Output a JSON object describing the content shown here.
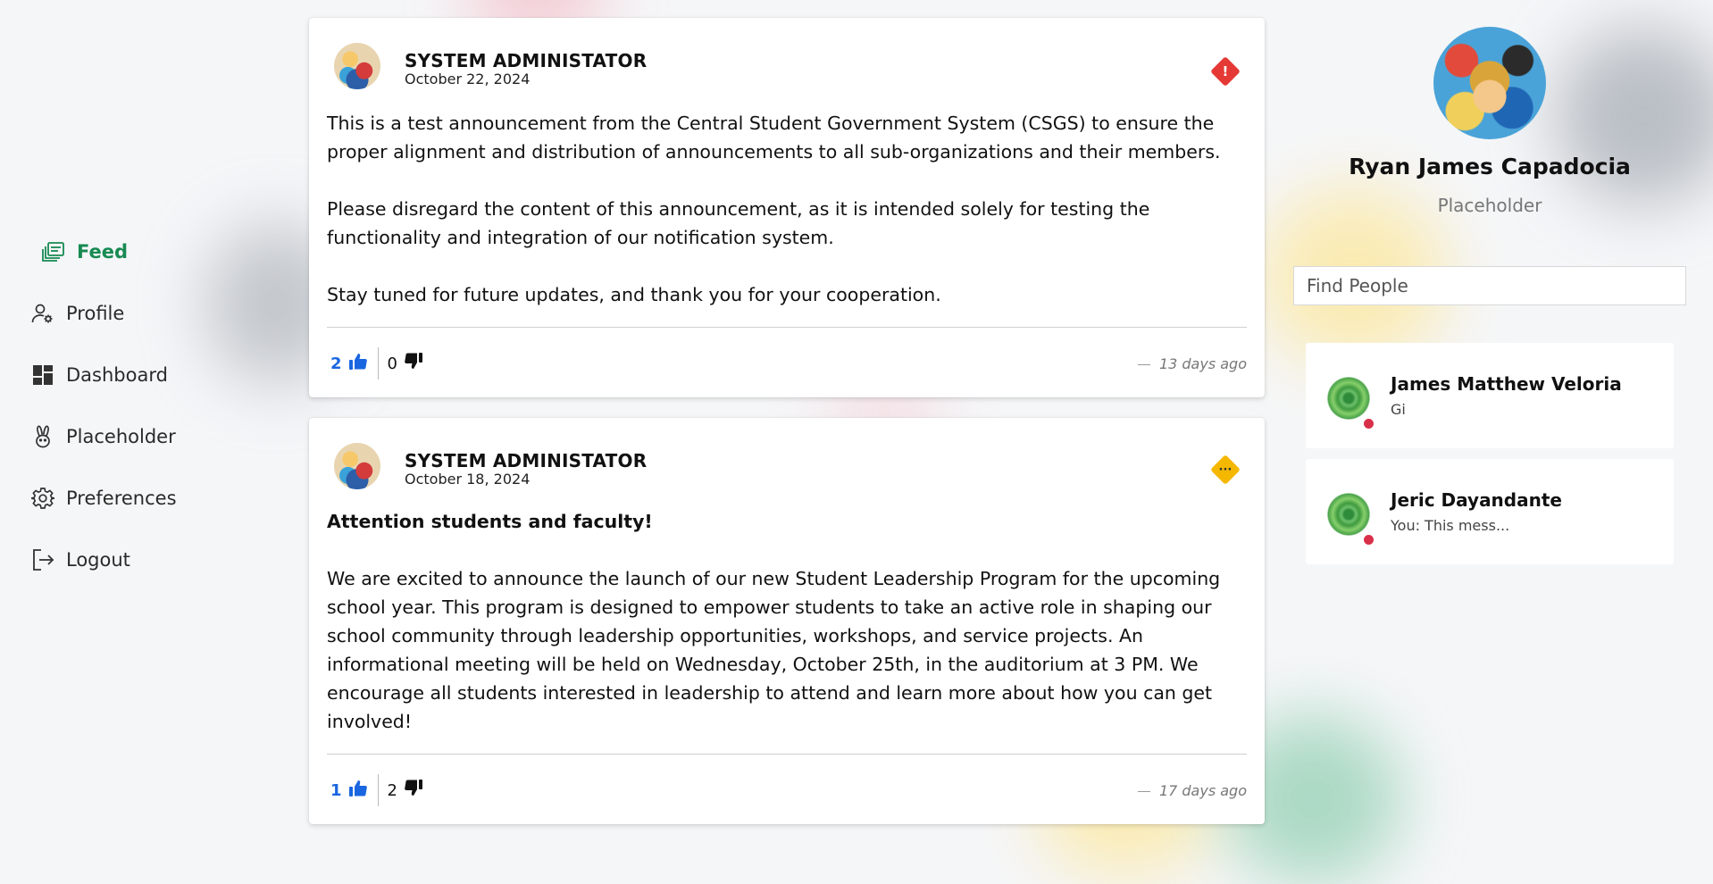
{
  "nav": {
    "items": [
      {
        "label": "Feed",
        "icon": "feed-icon",
        "active": true
      },
      {
        "label": "Profile",
        "icon": "user-settings-icon"
      },
      {
        "label": "Dashboard",
        "icon": "dashboard-icon"
      },
      {
        "label": "Placeholder",
        "icon": "rabbit-icon"
      },
      {
        "label": "Preferences",
        "icon": "gear-icon"
      },
      {
        "label": "Logout",
        "icon": "logout-icon"
      }
    ]
  },
  "posts": [
    {
      "author": "SYSTEM ADMINISTATOR",
      "date": "October 22, 2024",
      "priority_icon": "exclamation-diamond-icon",
      "priority_color": "#e53935",
      "paragraphs": [
        "This is a test announcement from the Central Student Government System (CSGS) to ensure the proper alignment and distribution of announcements to all sub-organizations and their members.",
        "Please disregard the content of this announcement, as it is intended solely for testing the functionality and integration of our notification system.",
        "Stay tuned for future updates, and thank you for your cooperation."
      ],
      "likes": "2",
      "dislikes": "0",
      "time_ago": "13 days ago"
    },
    {
      "author": "SYSTEM ADMINISTATOR",
      "date": "October 18, 2024",
      "priority_icon": "ellipsis-diamond-icon",
      "priority_color": "#f5b800",
      "headline": "Attention students and faculty!",
      "paragraphs": [
        "We are excited to announce the launch of our new Student Leadership Program for the upcoming school year. This program is designed to empower students to take an active role in shaping our school community through leadership opportunities, workshops, and service projects. An informational meeting will be held on Wednesday, October 25th, in the auditorium at 3 PM. We encourage all students interested in leadership to attend and learn more about how you can get involved!"
      ],
      "likes": "1",
      "dislikes": "2",
      "time_ago": "17 days ago"
    }
  ],
  "profile": {
    "name": "Ryan James Capadocia",
    "subtitle": "Placeholder"
  },
  "search": {
    "placeholder": "Find People"
  },
  "chats": [
    {
      "name": "James Matthew Veloria",
      "message": "Gi",
      "status_color": "#d9304a"
    },
    {
      "name": "Jeric Dayandante",
      "message": "You: This mess...",
      "status_color": "#d9304a"
    }
  ],
  "colors": {
    "accent_green": "#178a52",
    "like_blue": "#1a66e0"
  }
}
